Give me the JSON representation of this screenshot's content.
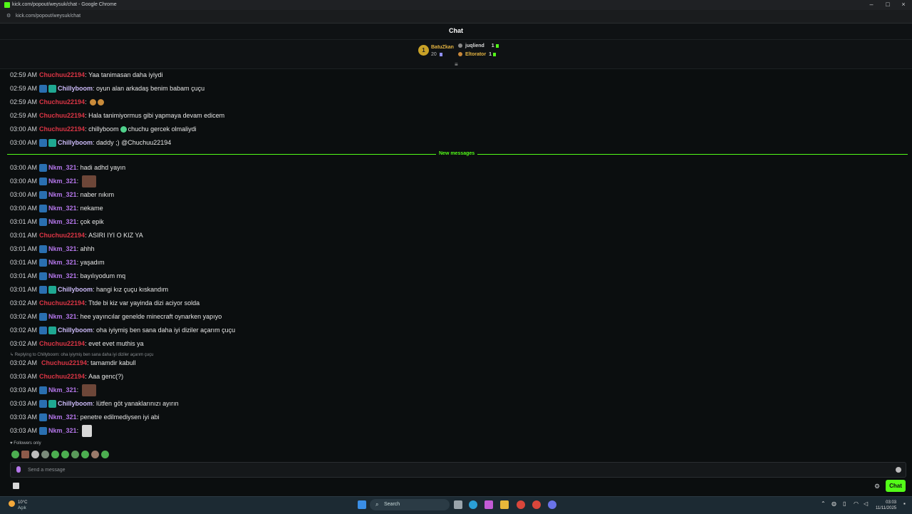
{
  "window": {
    "title": "kick.com/popout/weysuk/chat - Google Chrome",
    "url": "kick.com/popout/weysuk/chat"
  },
  "chat": {
    "header": "Chat",
    "leaderboard": {
      "first": {
        "rank": "1",
        "name": "BatuZkan",
        "count": "20"
      },
      "others": [
        {
          "name": "juqliend",
          "count": "1"
        },
        {
          "name": "Eltorator",
          "count": "1"
        }
      ]
    },
    "new_messages_label": "New messages",
    "reply_context": "Replying to Chillyboom: oha iyiymiş ben sana daha iyi diziler açarım çuçu",
    "followers_only": "Followers only",
    "input_placeholder": "Send a message",
    "send_label": "Chat",
    "messages": [
      {
        "time": "02:59 AM",
        "user": "Chuchuu22194",
        "text": "Yaa tanimasan daha iyiydi"
      },
      {
        "time": "02:59 AM",
        "user": "Chillyboom",
        "text": "oyun alan arkadaş benim babam çuçu"
      },
      {
        "time": "02:59 AM",
        "user": "Chuchuu22194",
        "text": ""
      },
      {
        "time": "02:59 AM",
        "user": "Chuchuu22194",
        "text": "Hala tanimiyormus gibi yapmaya devam edicem"
      },
      {
        "time": "03:00 AM",
        "user": "Chuchuu22194",
        "text_a": "chillyboom",
        "text_b": "chuchu gercek olmaliydi"
      },
      {
        "time": "03:00 AM",
        "user": "Chillyboom",
        "text": "daddy ;) @Chuchuu22194"
      },
      {
        "time": "03:00 AM",
        "user": "Nkm_321",
        "text": "hadi adhd yayın"
      },
      {
        "time": "03:00 AM",
        "user": "Nkm_321",
        "text": ""
      },
      {
        "time": "03:00 AM",
        "user": "Nkm_321",
        "text": "naber nıkım"
      },
      {
        "time": "03:00 AM",
        "user": "Nkm_321",
        "text": "nekame"
      },
      {
        "time": "03:01 AM",
        "user": "Nkm_321",
        "text": "çok epik"
      },
      {
        "time": "03:01 AM",
        "user": "Chuchuu22194",
        "text": "ASIRI IYI O KIZ YA"
      },
      {
        "time": "03:01 AM",
        "user": "Nkm_321",
        "text": "ahhh"
      },
      {
        "time": "03:01 AM",
        "user": "Nkm_321",
        "text": "yaşadım"
      },
      {
        "time": "03:01 AM",
        "user": "Nkm_321",
        "text": "bayılıyodum mq"
      },
      {
        "time": "03:01 AM",
        "user": "Chillyboom",
        "text": "hangi kız çuçu kıskandım"
      },
      {
        "time": "03:02 AM",
        "user": "Chuchuu22194",
        "text": "Ttde bi kiz var yayinda dizi aciyor solda"
      },
      {
        "time": "03:02 AM",
        "user": "Nkm_321",
        "text": "hee yayıncılar genelde minecraft oynarken yapıyo"
      },
      {
        "time": "03:02 AM",
        "user": "Chillyboom",
        "text": "oha iyiymiş ben sana daha iyi diziler açarım çuçu"
      },
      {
        "time": "03:02 AM",
        "user": "Chuchuu22194",
        "text": "evet evet muthis ya"
      },
      {
        "time": "03:02 AM",
        "user": "Chuchuu22194",
        "text": "tamamdir kabull"
      },
      {
        "time": "03:03 AM",
        "user": "Chuchuu22194",
        "text": "Aaa genc(?)"
      },
      {
        "time": "03:03 AM",
        "user": "Nkm_321",
        "text": ""
      },
      {
        "time": "03:03 AM",
        "user": "Chillyboom",
        "text": "lütfen göt yanaklarınızı ayırın"
      },
      {
        "time": "03:03 AM",
        "user": "Nkm_321",
        "text": "penetre edilmediysen iyi abi"
      },
      {
        "time": "03:03 AM",
        "user": "Nkm_321",
        "text": ""
      }
    ]
  },
  "taskbar": {
    "weather_temp": "10°C",
    "weather_cond": "Açık",
    "search_label": "Search",
    "time": "03:03",
    "date": "11/11/2025"
  },
  "colors": {
    "accent": "#53fc18",
    "chuchu": "#dc3545",
    "nkm": "#b476ea",
    "chilly": "#c9b8f5"
  }
}
